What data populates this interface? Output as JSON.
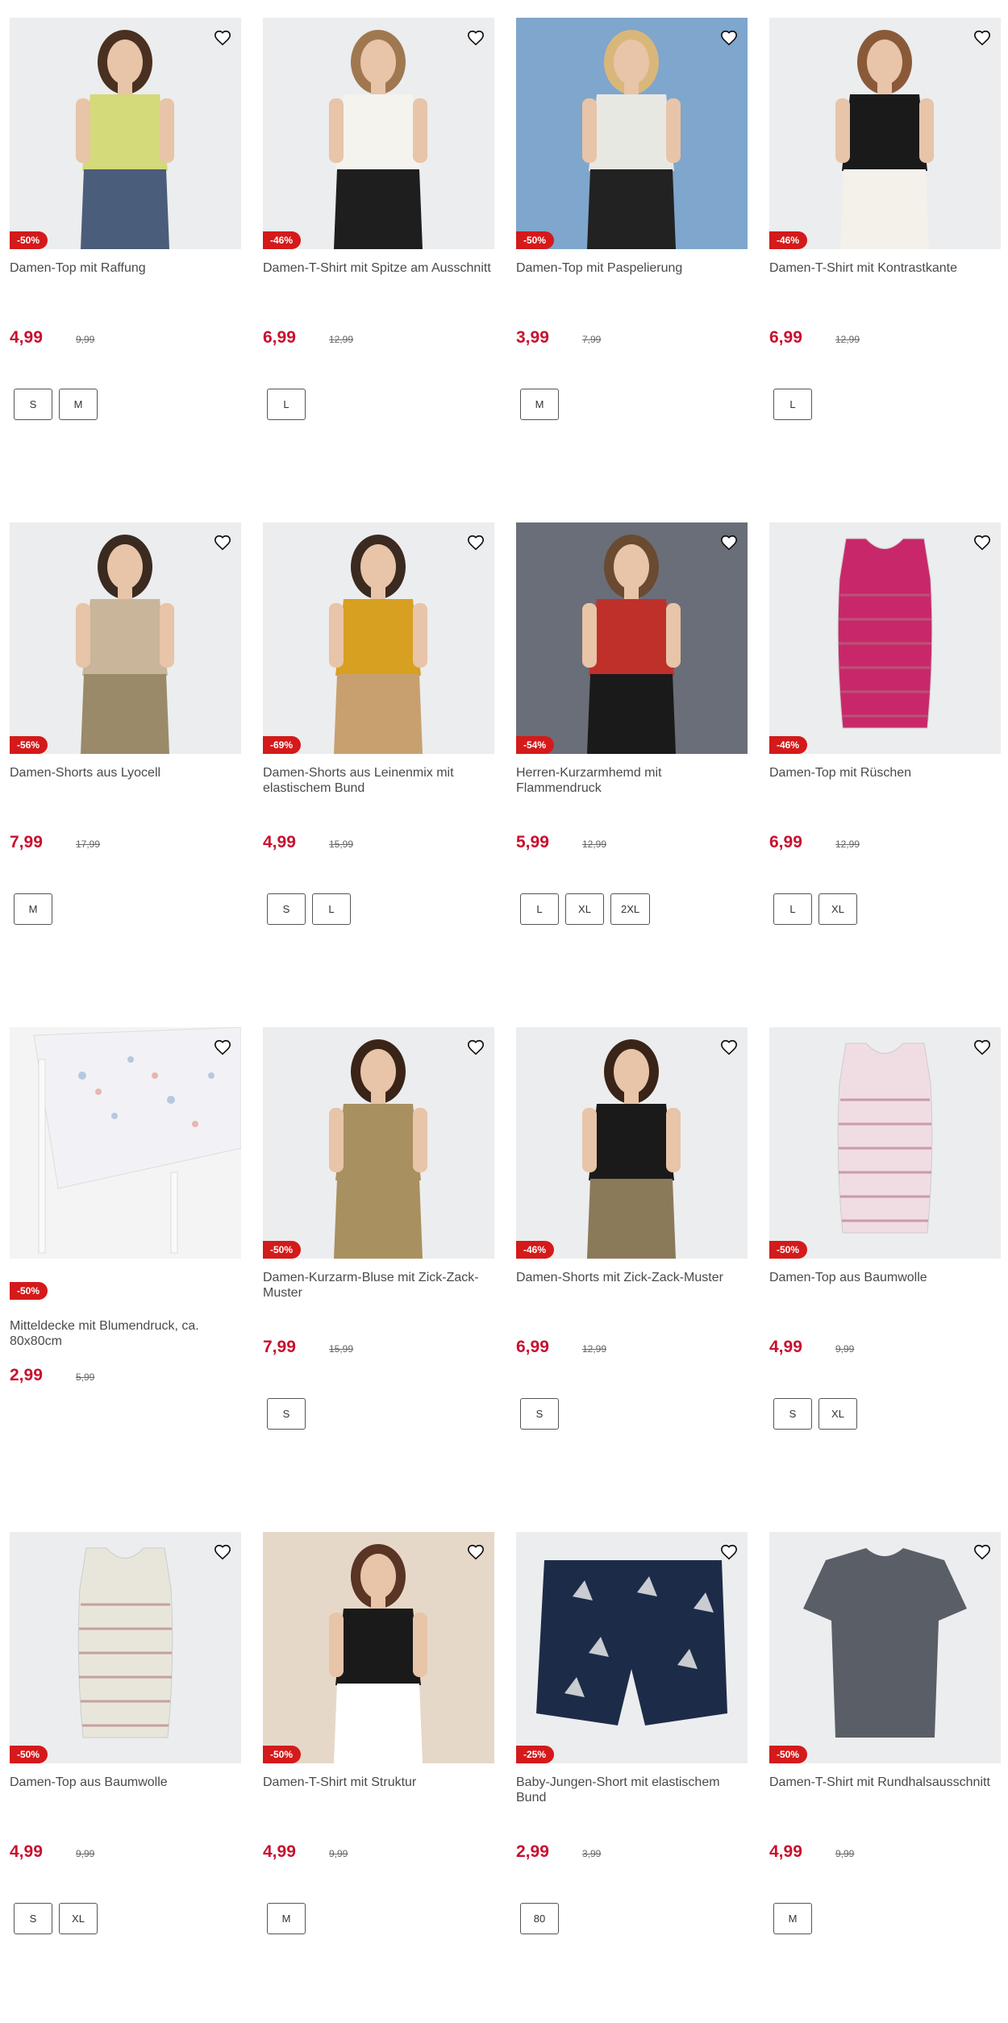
{
  "products": [
    {
      "name": "Damen-Top mit Raffung",
      "discount": "-50%",
      "price": "4,99",
      "old_price": "9,99",
      "sizes": [
        "S",
        "M"
      ],
      "bg": "#ecedee",
      "shirt": "#d4d97a",
      "pants": "#4a5d7a",
      "hair": "#4a3020"
    },
    {
      "name": "Damen-T-Shirt mit Spitze am Ausschnitt",
      "discount": "-46%",
      "price": "6,99",
      "old_price": "12,99",
      "sizes": [
        "L"
      ],
      "bg": "#ecedee",
      "shirt": "#f5f3ee",
      "pants": "#1e1e1e",
      "hair": "#a07850"
    },
    {
      "name": "Damen-Top mit Paspelierung",
      "discount": "-50%",
      "price": "3,99",
      "old_price": "7,99",
      "sizes": [
        "M"
      ],
      "bg": "#7fa6cc",
      "shirt": "#e8e8e2",
      "pants": "#222222",
      "hair": "#d9b77a"
    },
    {
      "name": "Damen-T-Shirt mit Kontrastkante",
      "discount": "-46%",
      "price": "6,99",
      "old_price": "12,99",
      "sizes": [
        "L"
      ],
      "bg": "#ecedee",
      "shirt": "#1a1a1a",
      "pants": "#f4f1ea",
      "hair": "#8a5a38"
    },
    {
      "name": "Damen-Shorts aus Lyocell",
      "discount": "-56%",
      "price": "7,99",
      "old_price": "17,99",
      "sizes": [
        "M"
      ],
      "bg": "#ecedee",
      "shirt": "#c9b69a",
      "pants": "#9a8a6a",
      "hair": "#3a2a20"
    },
    {
      "name": "Damen-Shorts aus Leinenmix mit elastischem Bund",
      "discount": "-69%",
      "price": "4,99",
      "old_price": "15,99",
      "sizes": [
        "S",
        "L"
      ],
      "bg": "#ecedee",
      "shirt": "#d8a020",
      "pants": "#c8a070",
      "hair": "#3a2a20"
    },
    {
      "name": "Herren-Kurzarmhemd mit Flammendruck",
      "discount": "-54%",
      "price": "5,99",
      "old_price": "12,99",
      "sizes": [
        "L",
        "XL",
        "2XL"
      ],
      "bg": "#6a6e78",
      "shirt": "#c0302a",
      "pants": "#1a1a1a",
      "hair": "#6a4a30"
    },
    {
      "name": "Damen-Top mit Rüschen",
      "discount": "-46%",
      "price": "6,99",
      "old_price": "12,99",
      "sizes": [
        "L",
        "XL"
      ],
      "bg": "#ecedee",
      "shirt": "#c8286a",
      "pants": "",
      "hair": ""
    },
    {
      "name": "Mitteldecke mit Blumendruck, ca. 80x80cm",
      "discount": "-50%",
      "price": "2,99",
      "old_price": "5,99",
      "sizes": [],
      "bg": "#f4f4f4",
      "shirt": "#f2f2f6",
      "pants": "",
      "hair": ""
    },
    {
      "name": "Damen-Kurzarm-Bluse mit Zick-Zack-Muster",
      "discount": "-50%",
      "price": "7,99",
      "old_price": "15,99",
      "sizes": [
        "S"
      ],
      "bg": "#ecedee",
      "shirt": "#a89060",
      "pants": "#a89060",
      "hair": "#3a2418"
    },
    {
      "name": "Damen-Shorts mit Zick-Zack-Muster",
      "discount": "-46%",
      "price": "6,99",
      "old_price": "12,99",
      "sizes": [
        "S"
      ],
      "bg": "#ecedee",
      "shirt": "#1a1a1a",
      "pants": "#8a7a5a",
      "hair": "#3a2418"
    },
    {
      "name": "Damen-Top aus Baumwolle",
      "discount": "-50%",
      "price": "4,99",
      "old_price": "9,99",
      "sizes": [
        "S",
        "XL"
      ],
      "bg": "#ecedee",
      "shirt": "#f0dde4",
      "pants": "",
      "hair": ""
    },
    {
      "name": "Damen-Top aus Baumwolle",
      "discount": "-50%",
      "price": "4,99",
      "old_price": "9,99",
      "sizes": [
        "S",
        "XL"
      ],
      "bg": "#ecedee",
      "shirt": "#e8e6da",
      "pants": "",
      "hair": ""
    },
    {
      "name": "Damen-T-Shirt mit Struktur",
      "discount": "-50%",
      "price": "4,99",
      "old_price": "9,99",
      "sizes": [
        "M"
      ],
      "bg": "#e6d8c8",
      "shirt": "#1a1a1a",
      "pants": "#ffffff",
      "hair": "#5a3424"
    },
    {
      "name": "Baby-Jungen-Short mit elastischem Bund",
      "discount": "-25%",
      "price": "2,99",
      "old_price": "3,99",
      "sizes": [
        "80"
      ],
      "bg": "#ecedee",
      "shirt": "#1c2c48",
      "pants": "",
      "hair": ""
    },
    {
      "name": "Damen-T-Shirt mit Rundhalsausschnitt",
      "discount": "-50%",
      "price": "4,99",
      "old_price": "9,99",
      "sizes": [
        "M"
      ],
      "bg": "#ecedee",
      "shirt": "#5a5e66",
      "pants": "",
      "hair": ""
    }
  ]
}
